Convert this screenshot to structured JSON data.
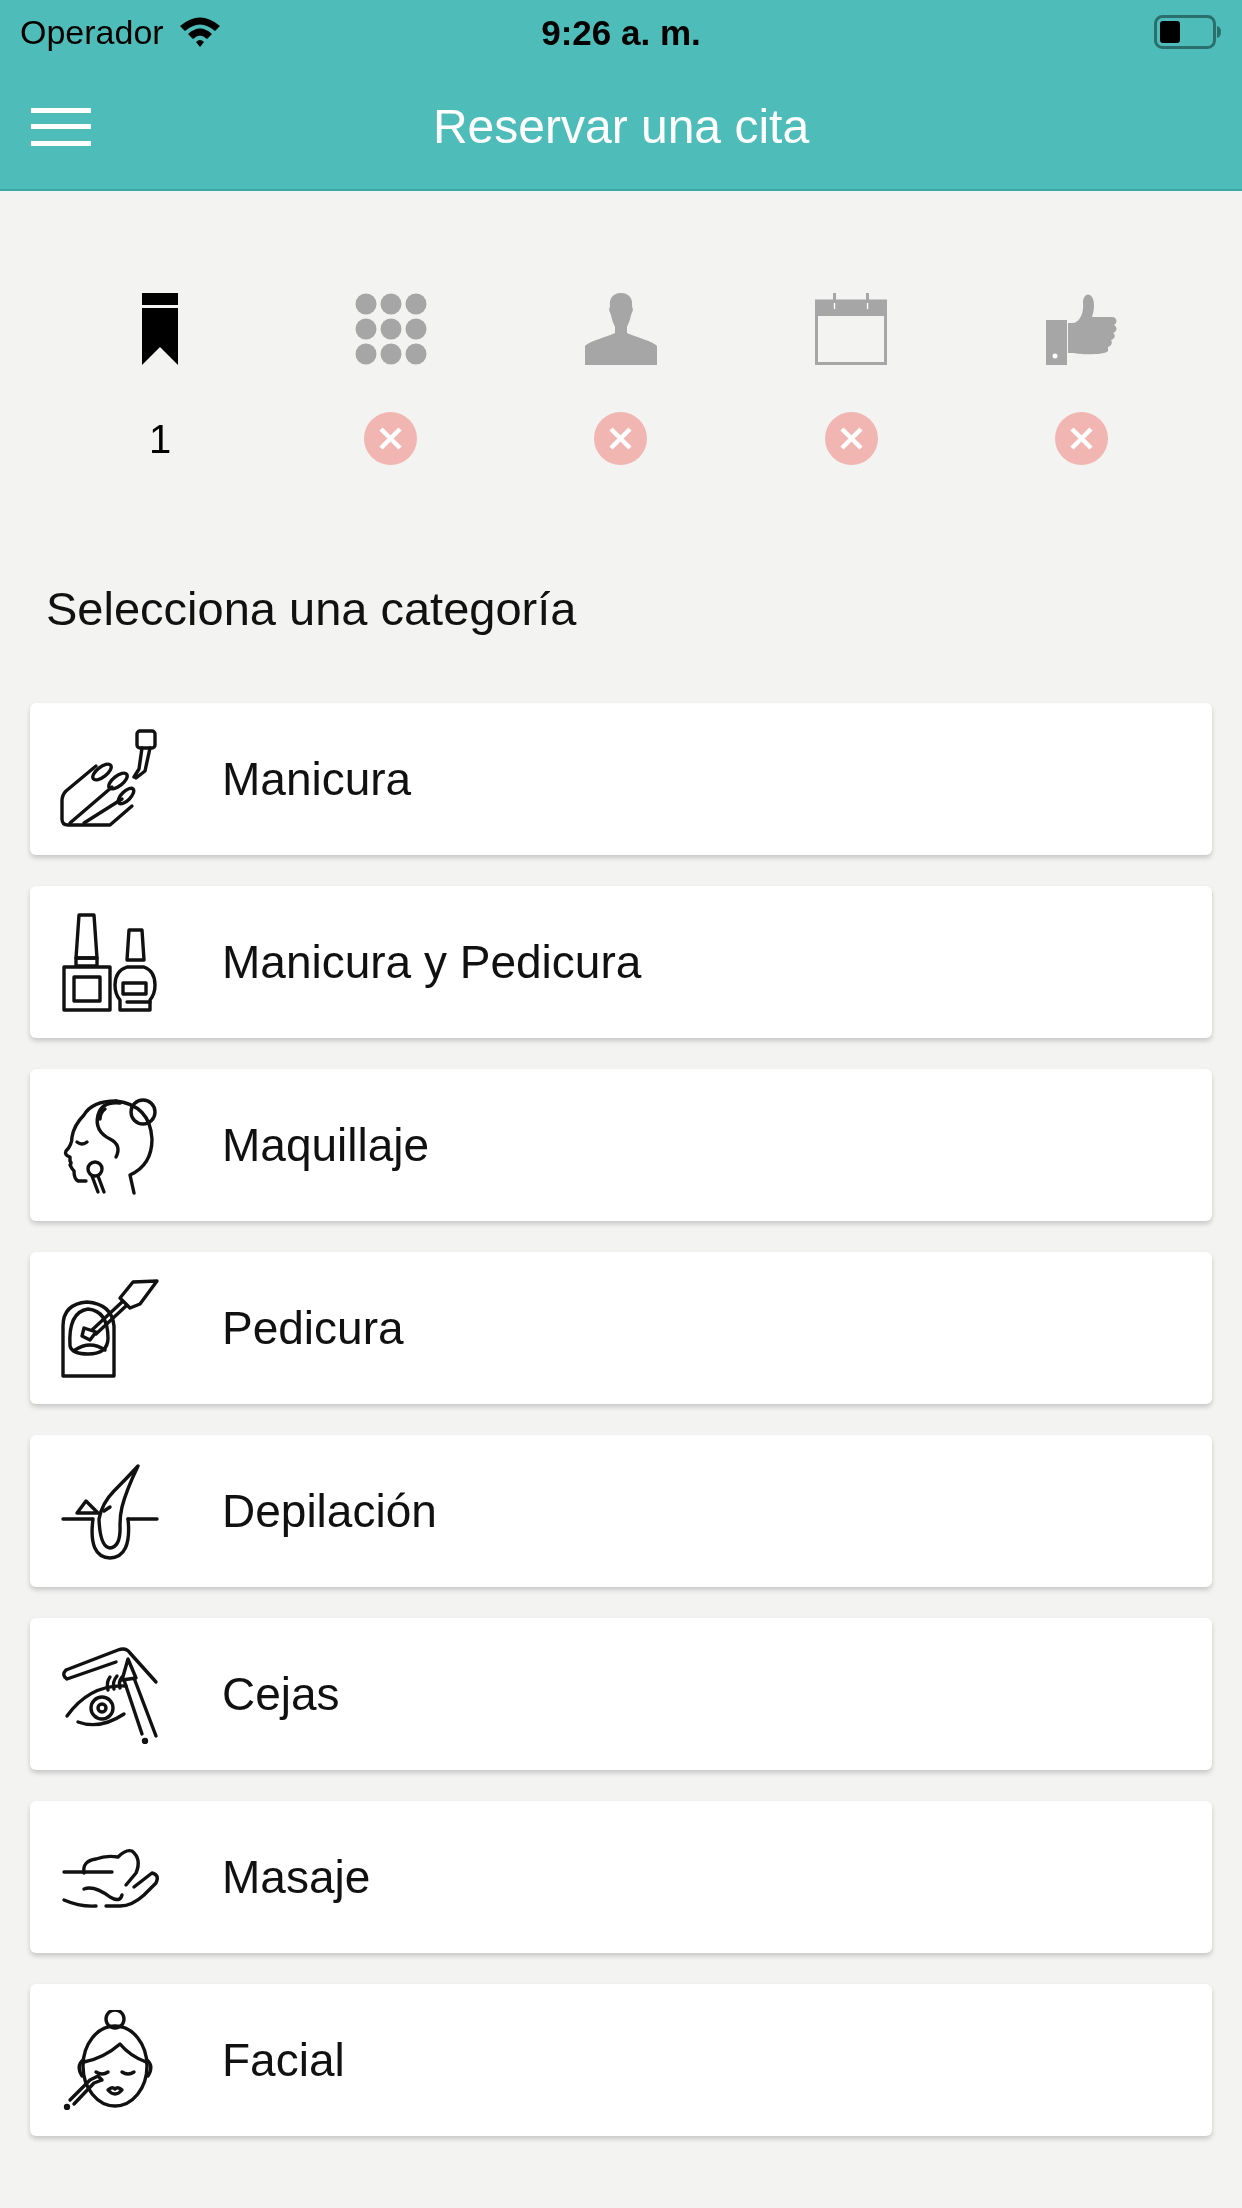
{
  "status_bar": {
    "carrier": "Operador",
    "time": "9:26 a. m."
  },
  "nav_bar": {
    "title": "Reservar una cita"
  },
  "steps": [
    {
      "selected": true,
      "number": "1"
    },
    {
      "selected": false
    },
    {
      "selected": false
    },
    {
      "selected": false
    },
    {
      "selected": false
    }
  ],
  "section": {
    "heading": "Selecciona una categoría"
  },
  "categories": [
    {
      "label": "Manicura"
    },
    {
      "label": "Manicura y Pedicura"
    },
    {
      "label": "Maquillaje"
    },
    {
      "label": "Pedicura"
    },
    {
      "label": "Depilación"
    },
    {
      "label": "Cejas"
    },
    {
      "label": "Masaje"
    },
    {
      "label": "Facial"
    }
  ]
}
